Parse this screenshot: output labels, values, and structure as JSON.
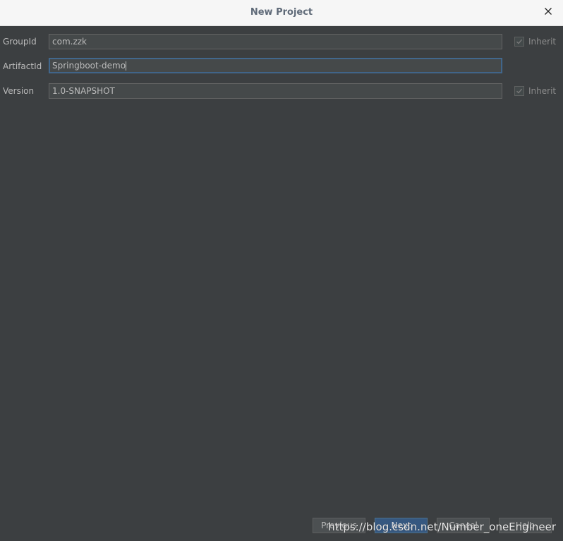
{
  "window": {
    "title": "New Project"
  },
  "fields": {
    "group_id": {
      "label": "GroupId",
      "value": "com.zzk",
      "inherit_label": "Inherit"
    },
    "artifact_id": {
      "label": "ArtifactId",
      "value": "Springboot-demo"
    },
    "version": {
      "label": "Version",
      "value": "1.0-SNAPSHOT",
      "inherit_label": "Inherit"
    }
  },
  "buttons": {
    "previous": "Previous",
    "next": "Next",
    "cancel": "Cancel",
    "help": "Help"
  },
  "watermark": "https://blog.csdn.net/Number_oneEngineer",
  "colors": {
    "background": "#3c3f41",
    "titlebar": "#f6f6f6",
    "focus_border": "#3d6185",
    "primary_button": "#365880"
  }
}
